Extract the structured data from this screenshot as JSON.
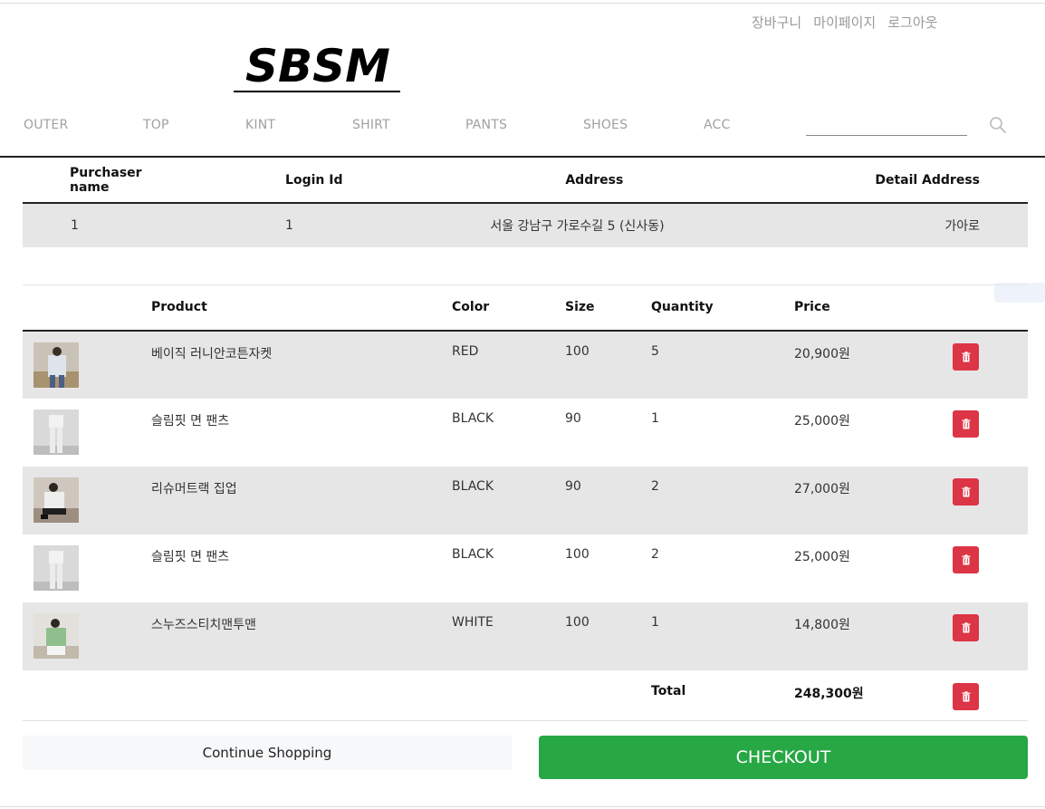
{
  "header": {
    "util_links": [
      "장바구니",
      "마이페이지",
      "로그아웃"
    ],
    "logo_text": "SBSM",
    "nav": [
      "OUTER",
      "TOP",
      "KINT",
      "SHIRT",
      "PANTS",
      "SHOES",
      "ACC"
    ],
    "search": {
      "placeholder": "",
      "value": ""
    }
  },
  "buyer": {
    "headers": [
      "Purchaser name",
      "Login Id",
      "Address",
      "Detail Address"
    ],
    "row": {
      "name": "1",
      "login_id": "1",
      "address": "서울 강남구 가로수길 5 (신사동)",
      "detail_address": "가아로"
    }
  },
  "order": {
    "headers": [
      "",
      "Product",
      "Color",
      "Size",
      "Quantity",
      "Price",
      ""
    ],
    "items": [
      {
        "product": "베이직 러니안코튼자켓",
        "color": "RED",
        "size": "100",
        "quantity": "5",
        "price": "20,900원"
      },
      {
        "product": "슬림핏 면 팬츠",
        "color": "BLACK",
        "size": "90",
        "quantity": "1",
        "price": "25,000원"
      },
      {
        "product": "리슈머트랙 집업",
        "color": "BLACK",
        "size": "90",
        "quantity": "2",
        "price": "27,000원"
      },
      {
        "product": "슬림핏 면 팬츠",
        "color": "BLACK",
        "size": "100",
        "quantity": "2",
        "price": "25,000원"
      },
      {
        "product": "스누즈스티치맨투맨",
        "color": "WHITE",
        "size": "100",
        "quantity": "1",
        "price": "14,800원"
      }
    ],
    "total_label": "Total",
    "total_value": "248,300원"
  },
  "actions": {
    "continue_label": "Continue Shopping",
    "checkout_label": "CHECKOUT"
  },
  "colors": {
    "delete": "#dc3545",
    "checkout": "#28a745",
    "row_shade": "#e6e6e6"
  }
}
